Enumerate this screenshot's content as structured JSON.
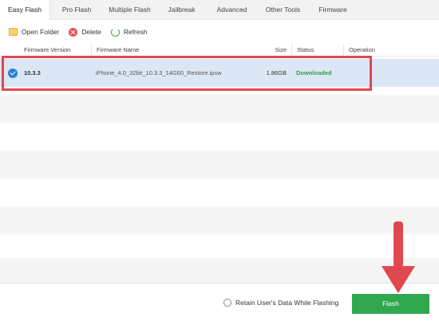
{
  "tabs": [
    {
      "label": "Easy Flash",
      "active": true
    },
    {
      "label": "Pro Flash",
      "active": false
    },
    {
      "label": "Multiple Flash",
      "active": false
    },
    {
      "label": "Jailbreak",
      "active": false
    },
    {
      "label": "Advanced",
      "active": false
    },
    {
      "label": "Other Tools",
      "active": false
    },
    {
      "label": "Firmware",
      "active": false
    }
  ],
  "toolbar": {
    "open_folder": {
      "label": "Open Folder",
      "icon": "folder-icon"
    },
    "delete": {
      "label": "Delete",
      "icon": "delete-icon"
    },
    "refresh": {
      "label": "Refresh",
      "icon": "refresh-icon"
    }
  },
  "table": {
    "columns": [
      "Firmware Version",
      "Firmware Name",
      "Size",
      "Status",
      "Operation"
    ],
    "rows": [
      {
        "selected": true,
        "version": "10.3.3",
        "name": "iPhone_4.0_32bit_10.3.3_14G60_Restore.ipsw",
        "size": "1.86GB",
        "status": "Downloaded",
        "operation": ""
      }
    ]
  },
  "footer": {
    "retain_label": "Retain User's Data While Flashing",
    "flash_label": "Flash"
  },
  "colors": {
    "accent_green": "#2fa84f",
    "highlight_red": "#e0484d",
    "selected_row": "#dbe7f5",
    "status_green": "#2f9e44"
  }
}
